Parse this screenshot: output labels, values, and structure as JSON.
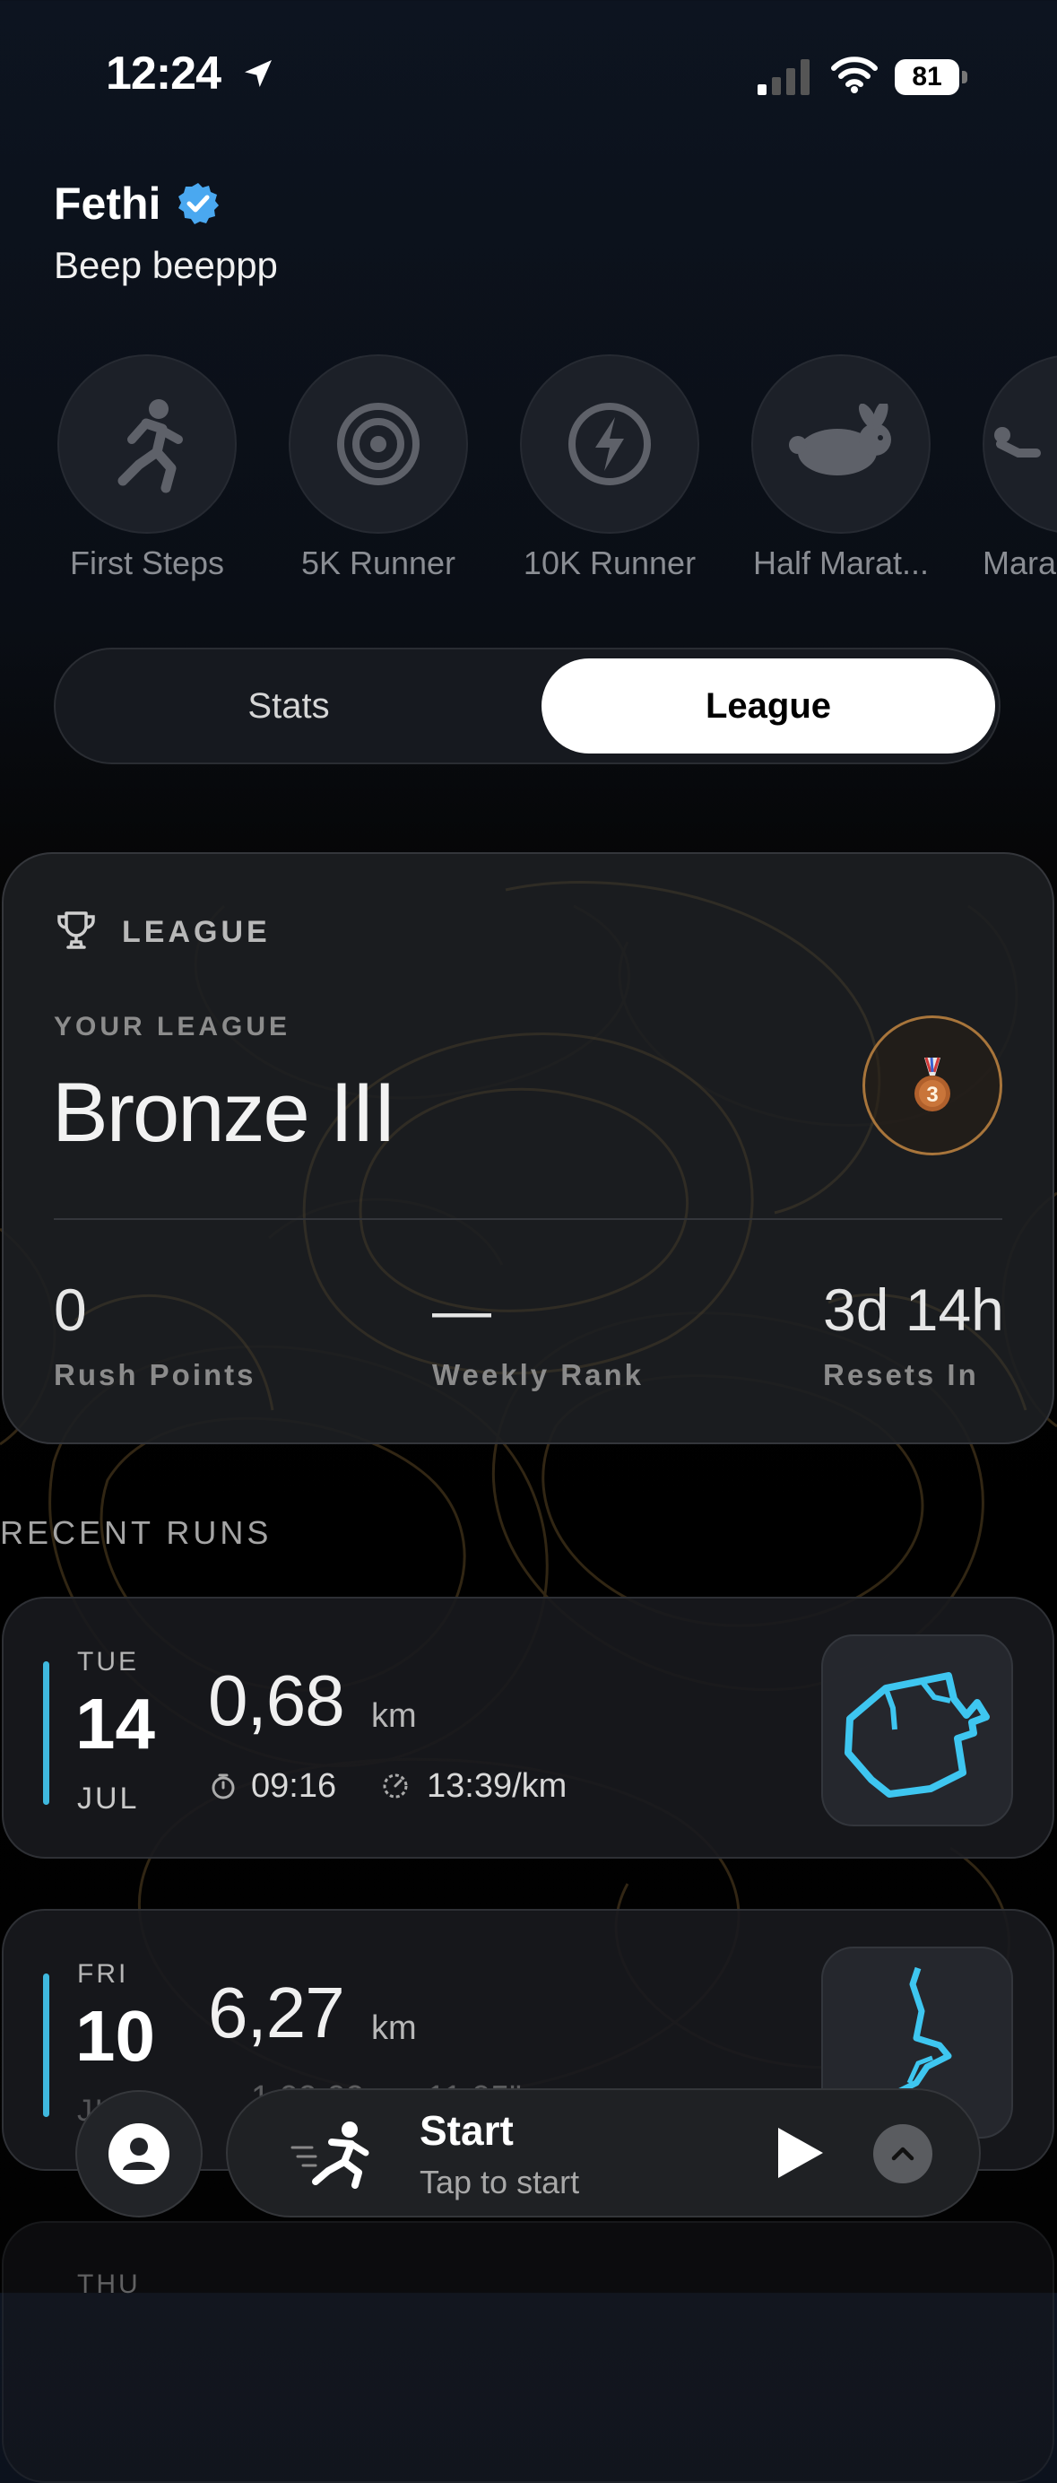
{
  "status_bar": {
    "time": "12:24",
    "battery": "81"
  },
  "profile": {
    "name": "Fethi",
    "bio": "Beep beeppp"
  },
  "badges": [
    {
      "label": "First Steps",
      "icon": "runner-icon"
    },
    {
      "label": "5K Runner",
      "icon": "target-icon"
    },
    {
      "label": "10K Runner",
      "icon": "bolt-icon"
    },
    {
      "label": "Half Marat...",
      "icon": "rabbit-icon"
    },
    {
      "label": "Mara",
      "icon": "marathon-icon"
    }
  ],
  "tabs": {
    "stats": "Stats",
    "league": "League",
    "selected": "League"
  },
  "league_card": {
    "title": "LEAGUE",
    "your_league_label": "YOUR LEAGUE",
    "league_name": "Bronze III",
    "medal_number": "3",
    "stats": [
      {
        "value": "0",
        "label": "Rush Points"
      },
      {
        "value": "—",
        "label": "Weekly Rank"
      },
      {
        "value": "3d 14h",
        "label": "Resets In"
      }
    ]
  },
  "recent_runs_title": "RECENT RUNS",
  "runs": [
    {
      "dow": "TUE",
      "day": "14",
      "month": "JUL",
      "distance": "0,68",
      "unit": "km",
      "duration": "09:16",
      "pace": "13:39/km"
    },
    {
      "dow": "FRI",
      "day": "10",
      "month": "JUL",
      "distance": "6,27",
      "unit": "km",
      "duration": "1:09:09",
      "pace": "11:05\""
    },
    {
      "dow": "THU"
    }
  ],
  "bottom_bar": {
    "start_title": "Start",
    "start_subtitle": "Tap to start"
  },
  "colors": {
    "accent_cyan": "#3fb8de",
    "medal_ring": "#a8753b",
    "verified_blue": "#4aa8f0"
  }
}
